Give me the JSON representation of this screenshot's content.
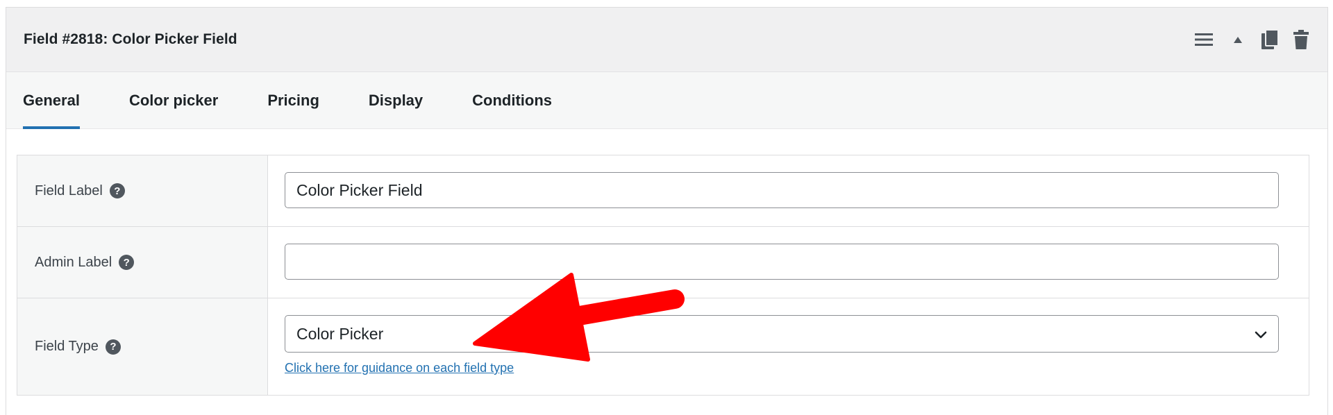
{
  "field_header": {
    "title": "Field #2818: Color Picker Field",
    "actions": [
      {
        "name": "hamburger-menu-icon"
      },
      {
        "name": "collapse-triangle-icon"
      },
      {
        "name": "duplicate-icon"
      },
      {
        "name": "trash-icon"
      }
    ]
  },
  "tabs": [
    {
      "label": "General",
      "active": true
    },
    {
      "label": "Color picker",
      "active": false
    },
    {
      "label": "Pricing",
      "active": false
    },
    {
      "label": "Display",
      "active": false
    },
    {
      "label": "Conditions",
      "active": false
    }
  ],
  "form": {
    "field_label": {
      "label": "Field Label",
      "value": "Color Picker Field",
      "placeholder": ""
    },
    "admin_label": {
      "label": "Admin Label",
      "value": "",
      "placeholder": ""
    },
    "field_type": {
      "label": "Field Type",
      "selected": "Color Picker",
      "guide_link": "Click here for guidance on each field type"
    },
    "help_glyph": "?"
  },
  "colors": {
    "accent": "#2271b1",
    "annotation_arrow": "#ff0000",
    "header_bg": "#f0f0f1",
    "tabs_bg": "#f6f7f7"
  }
}
